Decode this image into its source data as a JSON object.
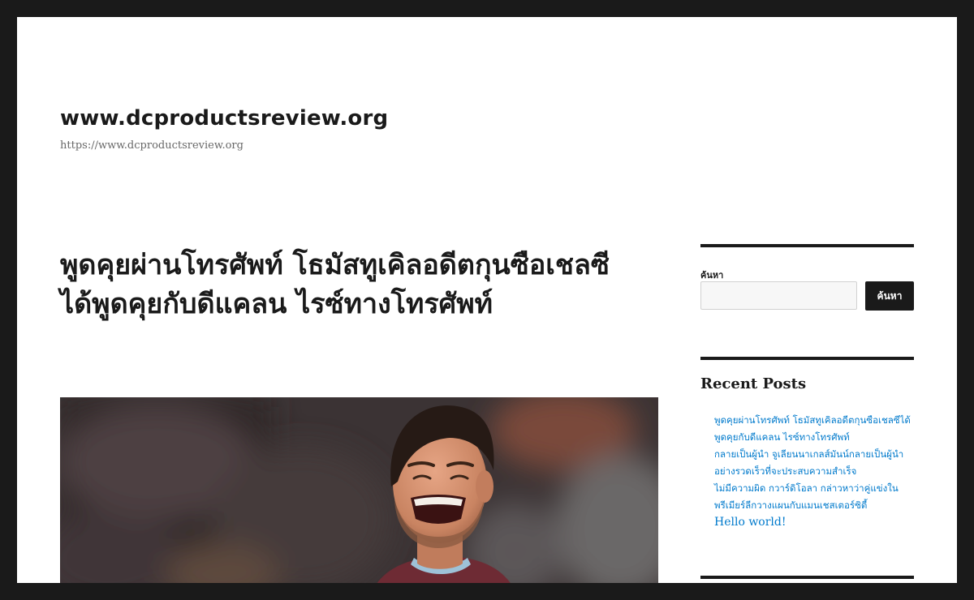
{
  "site": {
    "title": "www.dcproductsreview.org",
    "description": "https://www.dcproductsreview.org"
  },
  "post": {
    "title": "พูดคุยผ่านโทรศัพท์ โธมัสทูเคิลอดีตกุนซือเชลซีได้พูดคุยกับดีแคลน ไรซ์ทางโทรศัพท์"
  },
  "sidebar": {
    "search": {
      "label": "ค้นหา",
      "value": "",
      "placeholder": "",
      "button_label": "ค้นหา"
    },
    "recent_posts": {
      "title": "Recent Posts",
      "items": [
        {
          "label": "พูดคุยผ่านโทรศัพท์ โธมัสทูเคิลอดีตกุนซือเชลซีได้พูดคุยกับดีแคลน ไรซ์ทางโทรศัพท์"
        },
        {
          "label": "กลายเป็นผู้นำ จูเลียนนาเกลส์มันน์กลายเป็นผู้นำอย่างรวดเร็วที่จะประสบความสำเร็จ"
        },
        {
          "label": "ไม่มีความผิด กวาร์ดิโอลา กล่าวหาว่าคู่แข่งในพรีเมียร์ลีกวางแผนกับแมนเชสเตอร์ซิตี้"
        },
        {
          "label": "Hello world!"
        }
      ]
    }
  },
  "colors": {
    "frame": "#1a1a1a",
    "text": "#1a1a1a",
    "link": "#007acc",
    "muted": "#686868"
  }
}
